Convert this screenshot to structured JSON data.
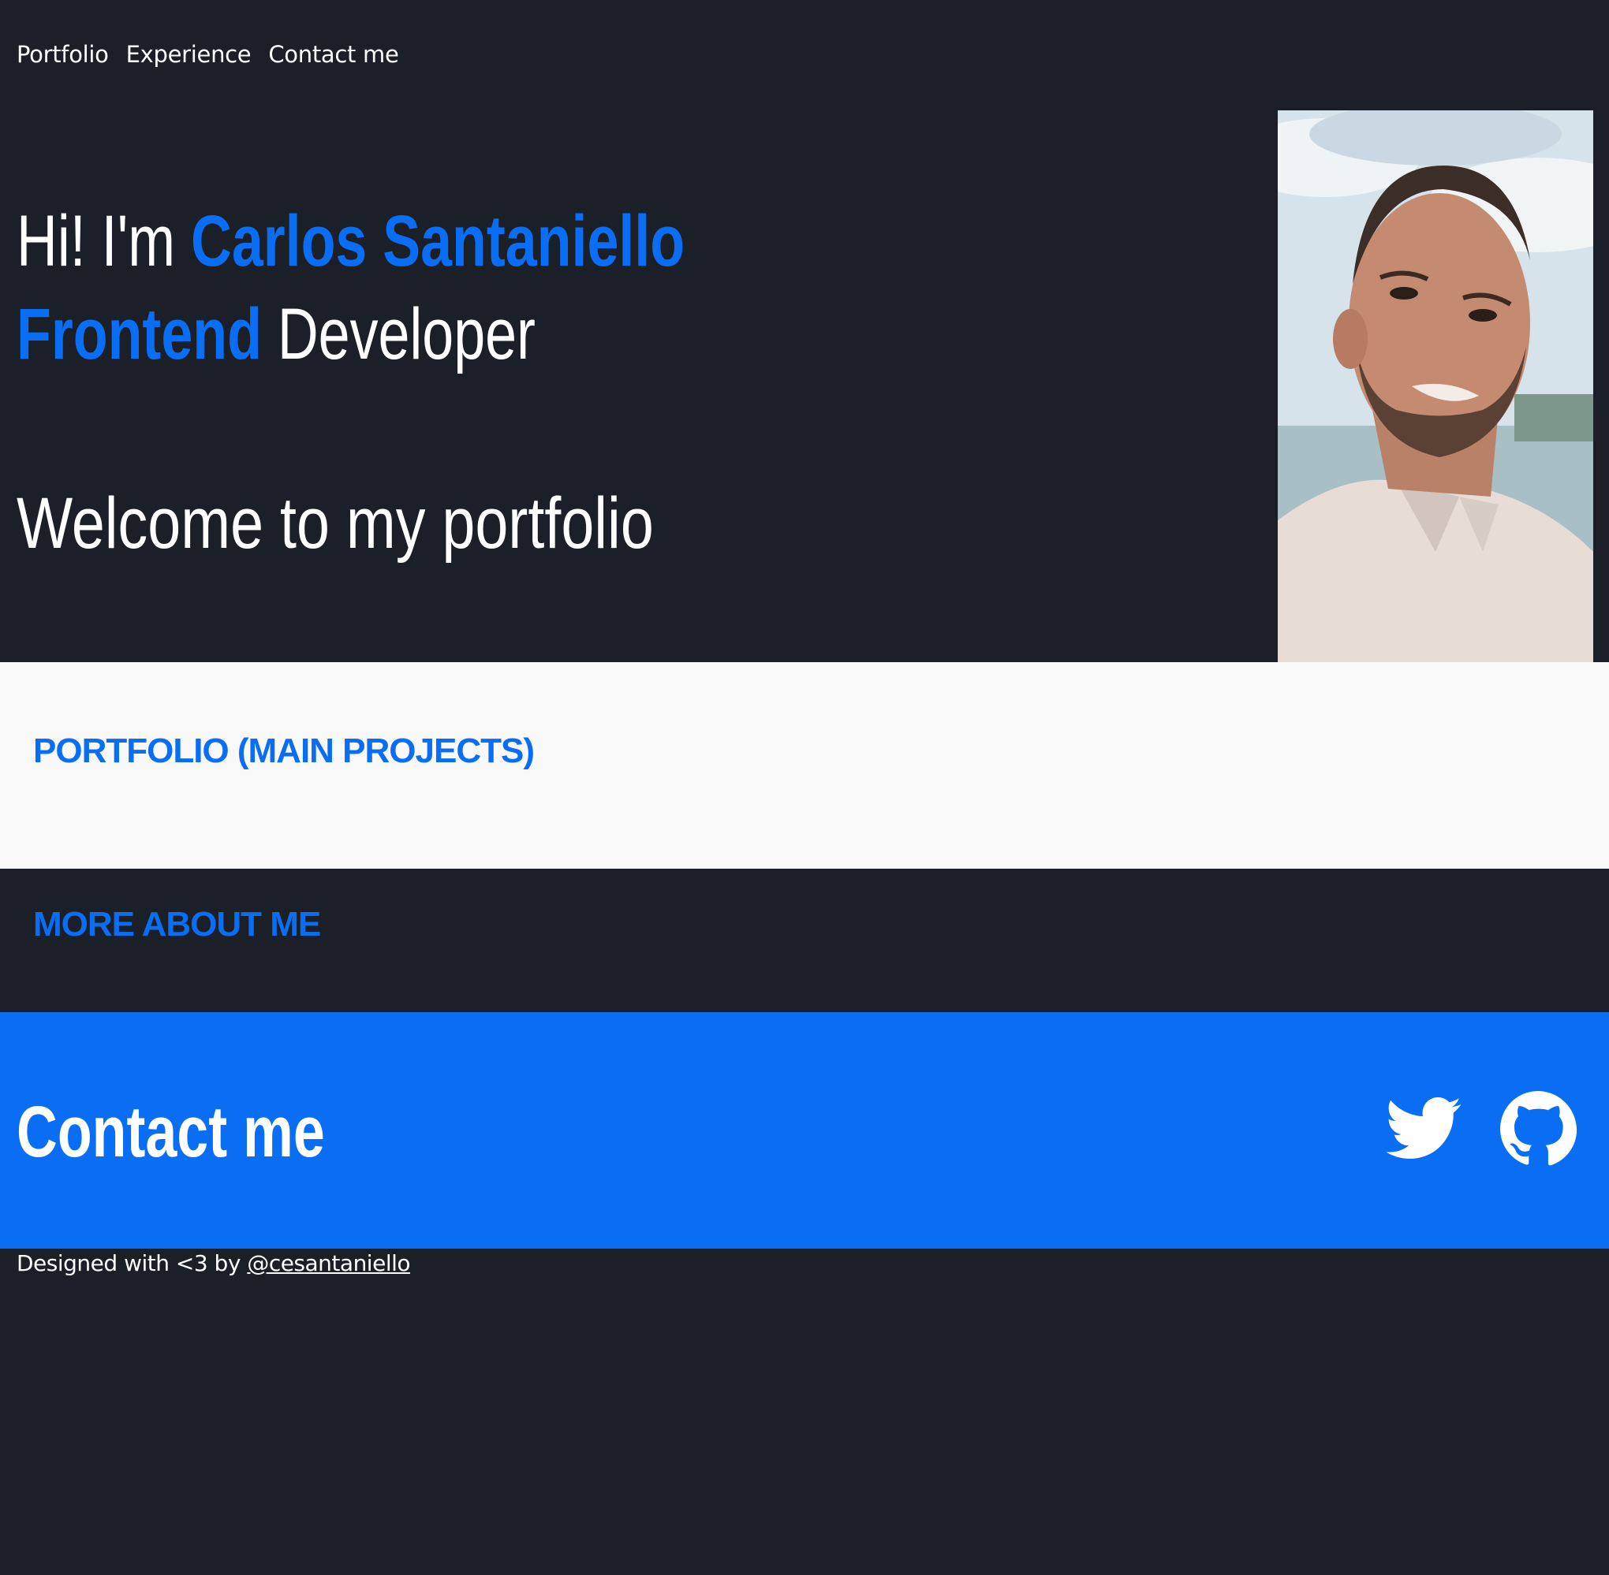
{
  "nav": {
    "items": [
      {
        "label": "Portfolio"
      },
      {
        "label": "Experience"
      },
      {
        "label": "Contact me"
      }
    ]
  },
  "hero": {
    "greeting": "Hi! I'm ",
    "name": "Carlos Santaniello",
    "role_accent": "Frontend",
    "role_rest": " Developer",
    "welcome": "Welcome to my portfolio"
  },
  "sections": {
    "portfolio_title": "PORTFOLIO (MAIN PROJECTS)",
    "about_title": "MORE ABOUT ME"
  },
  "contact": {
    "title": "Contact me",
    "icons": [
      "twitter-icon",
      "github-icon"
    ]
  },
  "footer": {
    "text": "Designed with <3 by ",
    "handle": "@cesantaniello"
  },
  "colors": {
    "background": "#1b1f27",
    "accent": "#0a6ef5",
    "light_section": "#f9f9f9",
    "text": "#ffffff"
  }
}
